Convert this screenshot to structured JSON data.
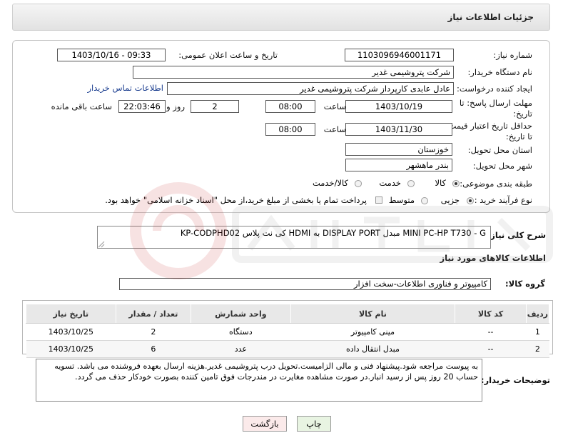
{
  "header": {
    "title": "جزئیات اطلاعات نیاز"
  },
  "form": {
    "need_number": {
      "label": "شماره نیاز:",
      "value": "1103096946001171"
    },
    "announce_datetime": {
      "label": "تاریخ و ساعت اعلان عمومی:",
      "value": "1403/10/16 - 09:33"
    },
    "buyer_org": {
      "label": "نام دستگاه خریدار:",
      "value": "شرکت پتروشیمی غدیر"
    },
    "requester": {
      "label": "ایجاد کننده درخواست:",
      "value": "عادل عابدی کارپرداز شرکت پتروشیمی غدیر",
      "contact_link": "اطلاعات تماس خریدار"
    },
    "reply_deadline": {
      "label": "مهلت ارسال پاسخ: تا تاریخ:",
      "date": "1403/10/19",
      "time_label": "ساعت",
      "time": "08:00",
      "days": "2",
      "days_label": "روز و",
      "remaining": "22:03:46",
      "remaining_label": "ساعت باقی مانده"
    },
    "price_validity": {
      "label": "حداقل تاریخ اعتبار قیمت: تا تاریخ:",
      "date": "1403/11/30",
      "time_label": "ساعت",
      "time": "08:00"
    },
    "province": {
      "label": "استان محل تحویل:",
      "value": "خوزستان"
    },
    "city": {
      "label": "شهر محل تحویل:",
      "value": "بندر ماهشهر"
    },
    "category": {
      "label": "طبقه بندی موضوعی:",
      "options": [
        "کالا",
        "خدمت",
        "کالا/خدمت"
      ],
      "selected": "کالا"
    },
    "purchase_type": {
      "label": "نوع فرآیند خرید :",
      "options": [
        "جزیی",
        "متوسط"
      ],
      "selected": "جزیی",
      "payment_note": "پرداخت تمام یا بخشی از مبلغ خرید،از محل \"اسناد خزانه اسلامی\" خواهد بود."
    }
  },
  "need_description": {
    "label": "شرح کلی نیاز:",
    "value": "MINI PC-HP T730 - G مبدل DISPLAY PORT به HDMI کی نت پلاس KP-CODPHD02"
  },
  "goods_section": {
    "title": "اطلاعات کالاهای مورد نیاز"
  },
  "goods_group": {
    "label": "گروه کالا:",
    "value": "کامپیوتر و فناوری اطلاعات-سخت افزار"
  },
  "table": {
    "headers": [
      "ردیف",
      "کد کالا",
      "نام کالا",
      "واحد شمارش",
      "تعداد / مقدار",
      "تاریخ نیاز"
    ],
    "rows": [
      [
        "1",
        "--",
        "مینی کامپیوتر",
        "دستگاه",
        "2",
        "1403/10/25"
      ],
      [
        "2",
        "--",
        "مبدل انتقال داده",
        "عدد",
        "6",
        "1403/10/25"
      ]
    ]
  },
  "buyer_notes": {
    "label": "توضیحات خریدار:",
    "value": "به پیوست مراجعه شود.پیشنهاد فنی و مالی الزامیست.تحویل درب پتروشیمی غدیر.هزینه ارسال بعهده فروشنده می باشد. تسویه حساب 20 روز پس از رسید انبار.در صورت مشاهده مغایرت در مندرجات فوق تامین کننده بصورت خودکار حذف می گردد."
  },
  "buttons": {
    "print": "چاپ",
    "back": "بازگشت"
  },
  "colors": {
    "link": "#1a3d8f",
    "back_button": "#fbeaea",
    "print_button": "#e8f4e2",
    "watermark": "#c62828"
  }
}
